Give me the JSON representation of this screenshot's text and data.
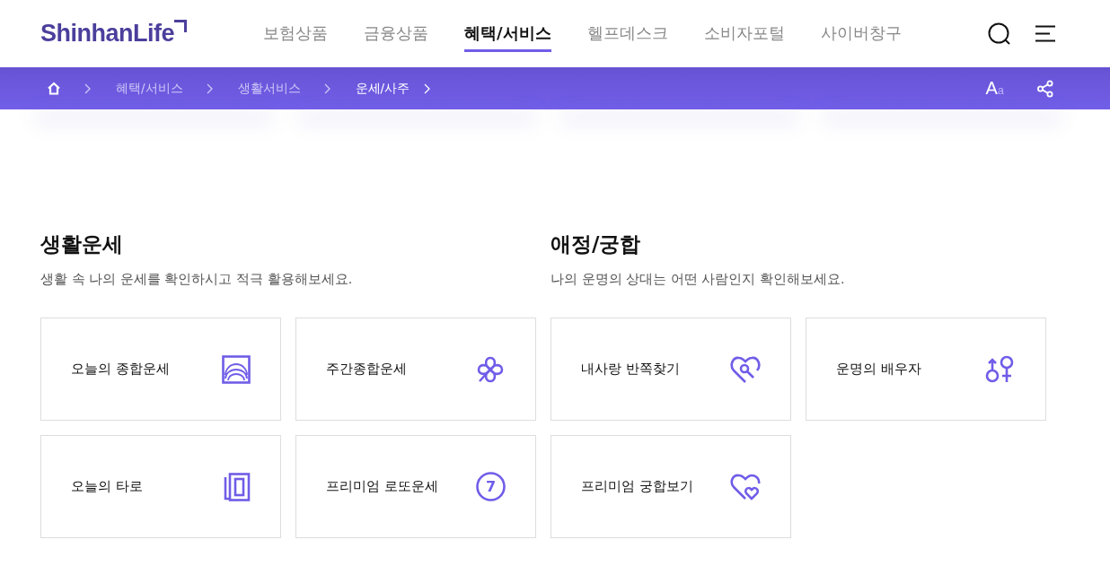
{
  "logo": {
    "text": "ShinhanLife"
  },
  "nav": [
    {
      "label": "보험상품",
      "selected": false
    },
    {
      "label": "금융상품",
      "selected": false
    },
    {
      "label": "혜택/서비스",
      "selected": true
    },
    {
      "label": "헬프데스크",
      "selected": false
    },
    {
      "label": "소비자포털",
      "selected": false
    },
    {
      "label": "사이버창구",
      "selected": false
    }
  ],
  "breadcrumb": [
    {
      "label": "혜택/서비스",
      "current": false
    },
    {
      "label": "생활서비스",
      "current": false
    },
    {
      "label": "운세/사주",
      "current": true
    }
  ],
  "font_size_button": {
    "big": "A",
    "small": "a"
  },
  "sections": [
    {
      "title": "생활운세",
      "subtitle": "생활 속 나의 운세를 확인하시고 적극 활용해보세요.",
      "cards": [
        {
          "label": "오늘의 종합운세",
          "kind": "sunrise"
        },
        {
          "label": "주간종합운세",
          "kind": "clover"
        },
        {
          "label": "오늘의 타로",
          "kind": "tarot"
        },
        {
          "label": "프리미엄 로또운세",
          "kind": "lotto",
          "icon_text": "7"
        }
      ]
    },
    {
      "title": "애정/궁합",
      "subtitle": "나의 운명의 상대는 어떤 사람인지 확인해보세요.",
      "cards": [
        {
          "label": "내사랑 반쪽찾기",
          "kind": "heart-search"
        },
        {
          "label": "운명의 배우자",
          "kind": "gender"
        },
        {
          "label": "프리미엄 궁합보기",
          "kind": "hearts"
        }
      ]
    }
  ]
}
